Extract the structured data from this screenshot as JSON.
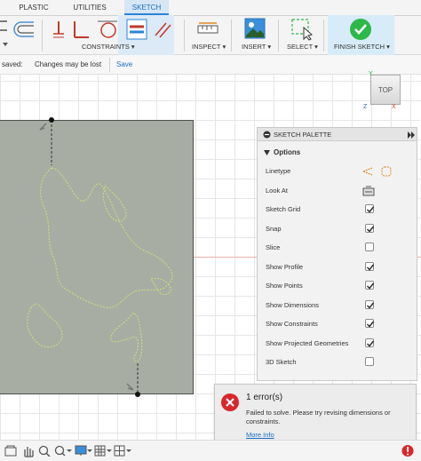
{
  "toolbar": {
    "tabs": [
      {
        "label": "PLASTIC"
      },
      {
        "label": "UTILITIES"
      },
      {
        "label": "SKETCH",
        "active": true
      }
    ],
    "groups": {
      "constraints": "CONSTRAINTS ▾",
      "inspect": "INSPECT ▾",
      "insert": "INSERT ▾",
      "select": "SELECT ▾",
      "finish": "FINISH SKETCH ▾"
    }
  },
  "save_bar": {
    "status_label": "saved:",
    "message": "Changes may be lost",
    "save_label": "Save"
  },
  "viewcube": {
    "face": "TOP",
    "axes": {
      "x": "X",
      "y": "Y",
      "z": "Z"
    }
  },
  "sketch_palette": {
    "title": "SKETCH PALETTE",
    "section": "Options",
    "rows": [
      {
        "label": "Linetype",
        "type": "icons"
      },
      {
        "label": "Look At",
        "type": "icon"
      },
      {
        "label": "Sketch Grid",
        "checked": true
      },
      {
        "label": "Snap",
        "checked": true
      },
      {
        "label": "Slice",
        "checked": false
      },
      {
        "label": "Show Profile",
        "checked": true
      },
      {
        "label": "Show Points",
        "checked": true
      },
      {
        "label": "Show Dimensions",
        "checked": true
      },
      {
        "label": "Show Constraints",
        "checked": true
      },
      {
        "label": "Show Projected Geometries",
        "checked": true
      },
      {
        "label": "3D Sketch",
        "checked": false
      }
    ]
  },
  "error_toast": {
    "title": "1 error(s)",
    "message": "Failed to solve. Please try revising dimensions or constraints.",
    "link": "More Info"
  },
  "colors": {
    "accent": "#2b84d6",
    "finish_green": "#2db84a",
    "error_red": "#d9262c",
    "sketch_fill": "#a8ada3",
    "sketch_curve": "#c9e07a"
  }
}
